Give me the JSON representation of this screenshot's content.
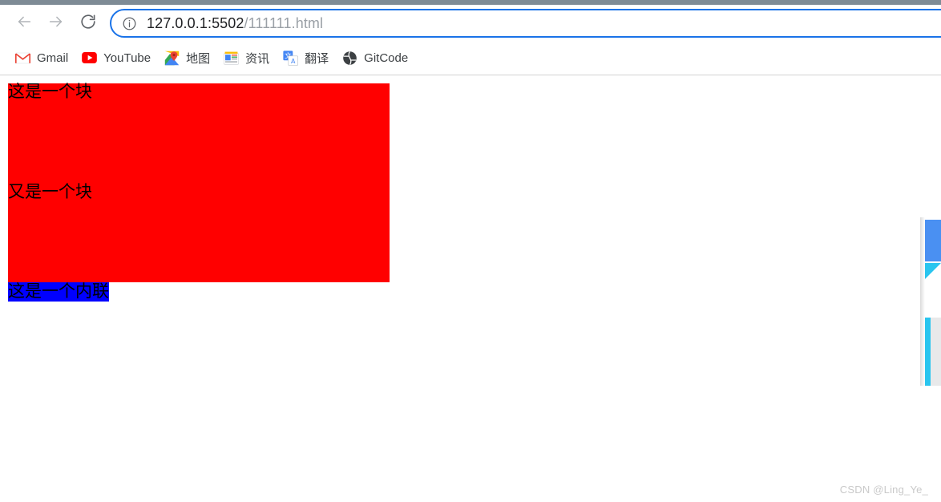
{
  "browser": {
    "nav": {
      "back_icon": "arrow-left-icon",
      "forward_icon": "arrow-right-icon",
      "reload_icon": "reload-icon"
    },
    "omnibox": {
      "info_icon": "page-info-icon",
      "url_host": "127.0.0.1:5502",
      "url_path": "/111111.html",
      "url_full": "127.0.0.1:5502/111111.html"
    },
    "bookmarks": [
      {
        "label": "Gmail",
        "icon": "gmail-icon"
      },
      {
        "label": "YouTube",
        "icon": "youtube-icon"
      },
      {
        "label": "地图",
        "icon": "google-maps-icon"
      },
      {
        "label": "资讯",
        "icon": "google-news-icon"
      },
      {
        "label": "翻译",
        "icon": "google-translate-icon"
      },
      {
        "label": "GitCode",
        "icon": "gitcode-globe-icon"
      }
    ]
  },
  "page": {
    "block_red": {
      "line1": "这是一个块",
      "line2": "又是一个块",
      "background_color": "#ff0000",
      "text_color": "#000000"
    },
    "inline_blue": {
      "text": "这是一个内联",
      "background_color": "#0000ff",
      "text_color": "#000000"
    }
  },
  "side_widget": {
    "blue_rect_color": "#4a90f2",
    "cyan_color": "#29c5ef",
    "panel_color": "#e8e9ea",
    "circle_color": "#3b82d6"
  },
  "watermark": {
    "text": "CSDN @Ling_Ye_"
  }
}
